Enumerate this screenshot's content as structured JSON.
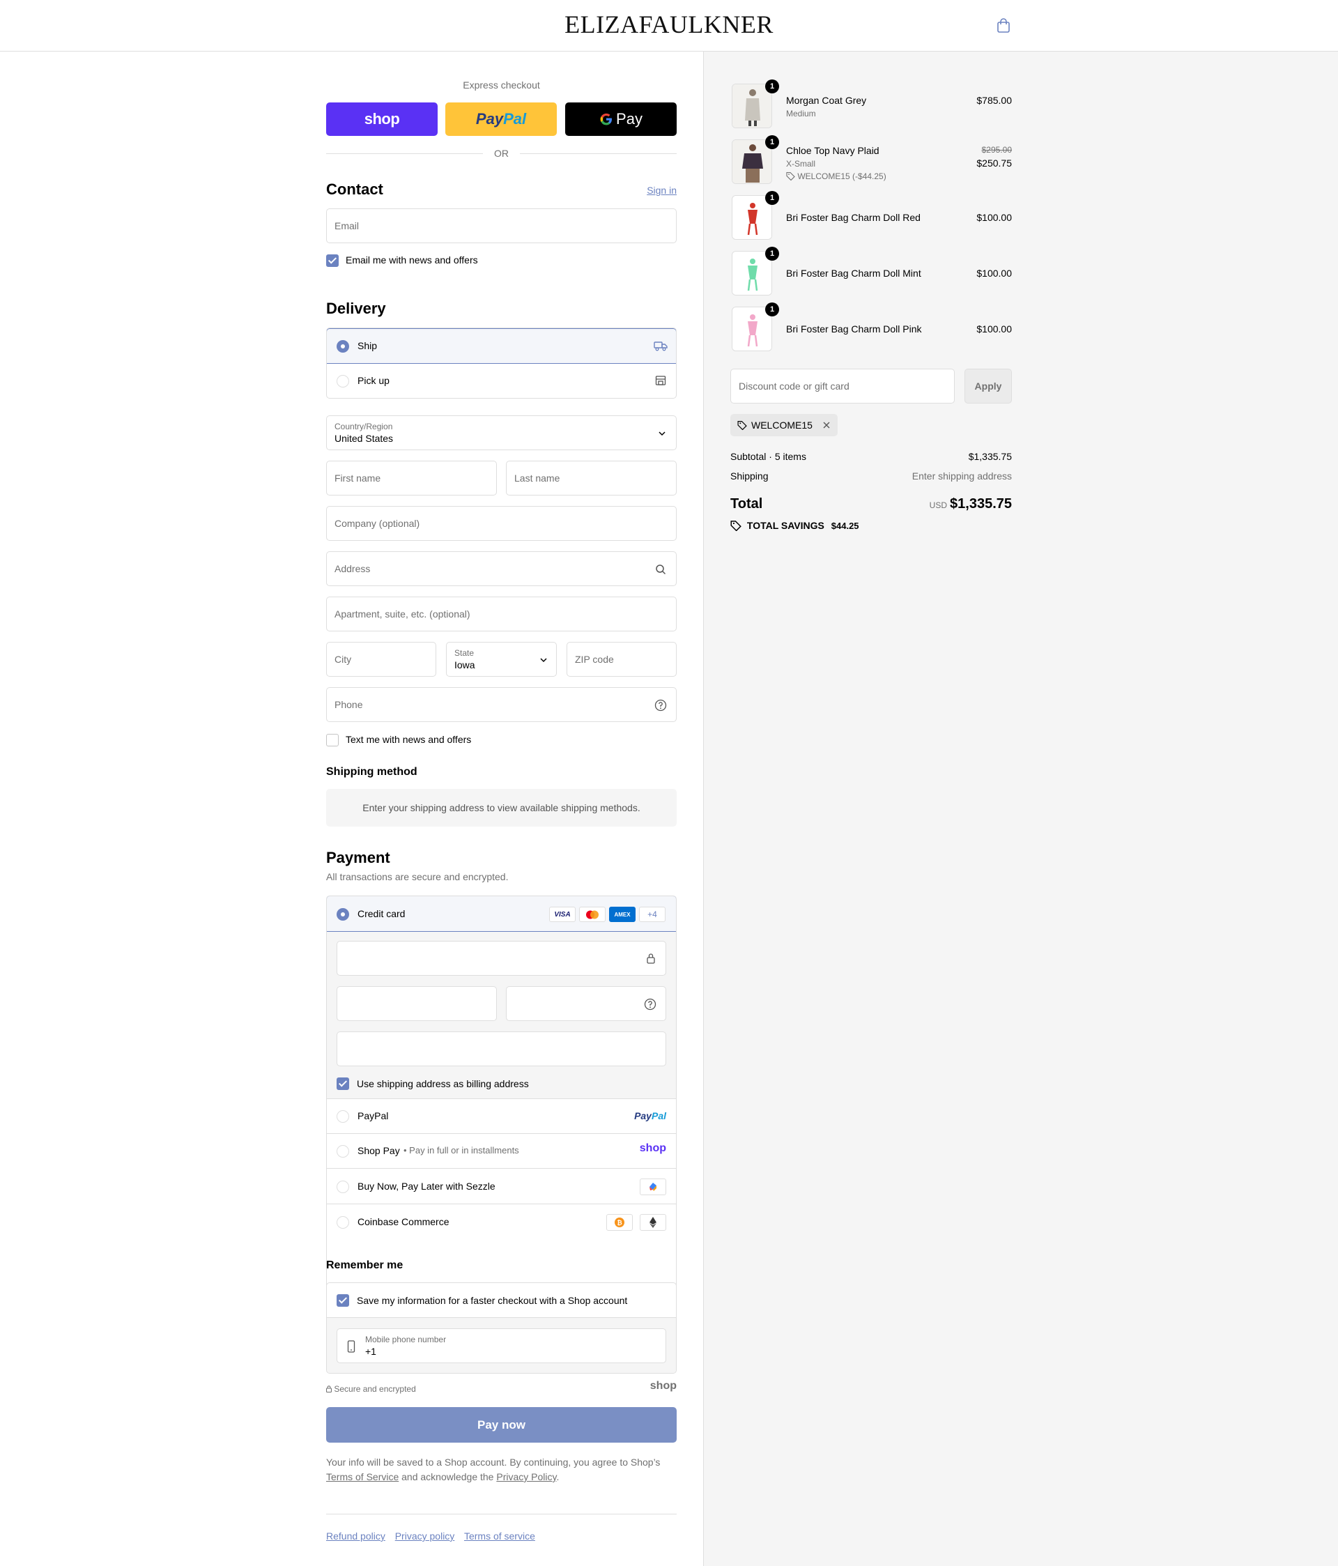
{
  "header": {
    "brand": "ELIZAFAULKNER",
    "cart_icon": "shopping-bag-icon"
  },
  "express": {
    "label": "Express checkout",
    "shop": "shop",
    "paypal_a": "Pay",
    "paypal_b": "Pal",
    "gpay": "Pay",
    "or": "OR"
  },
  "contact": {
    "title": "Contact",
    "sign_in": "Sign in",
    "email_placeholder": "Email",
    "news_label": "Email me with news and offers",
    "news_checked": true
  },
  "delivery": {
    "title": "Delivery",
    "options": [
      {
        "label": "Ship",
        "selected": true,
        "icon": "truck-icon"
      },
      {
        "label": "Pick up",
        "selected": false,
        "icon": "store-icon"
      }
    ],
    "country_label": "Country/Region",
    "country_value": "United States",
    "first_name": "First name",
    "last_name": "Last name",
    "company": "Company (optional)",
    "address": "Address",
    "apartment": "Apartment, suite, etc. (optional)",
    "city": "City",
    "state_label": "State",
    "state_value": "Iowa",
    "zip": "ZIP code",
    "phone": "Phone",
    "text_label": "Text me with news and offers",
    "text_checked": false
  },
  "shipping_method": {
    "title": "Shipping method",
    "info": "Enter your shipping address to view available shipping methods."
  },
  "payment": {
    "title": "Payment",
    "subtitle": "All transactions are secure and encrypted.",
    "credit_card": "Credit card",
    "card_brands": [
      "VISA",
      "",
      "AMEX",
      "+4"
    ],
    "billing_label": "Use shipping address as billing address",
    "billing_checked": true,
    "options": [
      {
        "label": "PayPal",
        "badge_a": "Pay",
        "badge_b": "Pal"
      },
      {
        "label": "Shop Pay",
        "sub": "Pay in full or in installments",
        "badge": "shop"
      },
      {
        "label": "Buy Now, Pay Later with Sezzle"
      },
      {
        "label": "Coinbase Commerce"
      }
    ]
  },
  "remember": {
    "title": "Remember me",
    "save_label": "Save my information for a faster checkout with a Shop account",
    "save_checked": true,
    "phone_label": "Mobile phone number",
    "phone_value": "+1",
    "secure": "Secure and encrypted",
    "shop": "shop"
  },
  "pay_button": "Pay now",
  "legal": {
    "line1": "Your info will be saved to a Shop account. By continuing, you agree to Shop’s",
    "tos": "Terms of Service",
    "mid": "and acknowledge the",
    "privacy": "Privacy Policy",
    "end": "."
  },
  "footer": {
    "links": [
      "Refund policy",
      "Privacy policy",
      "Terms of service"
    ]
  },
  "cart": {
    "items": [
      {
        "name": "Morgan Coat Grey",
        "variant": "Medium",
        "price": "$785.00",
        "qty": "1",
        "color": "#c9c5bd"
      },
      {
        "name": "Chloe Top Navy Plaid",
        "variant": "X-Small",
        "discount": "WELCOME15 (-$44.25)",
        "old_price": "$295.00",
        "price": "$250.75",
        "qty": "1",
        "color": "#3b2f3f"
      },
      {
        "name": "Bri Foster Bag Charm Doll Red",
        "price": "$100.00",
        "qty": "1",
        "color": "#d2362a"
      },
      {
        "name": "Bri Foster Bag Charm Doll Mint",
        "price": "$100.00",
        "qty": "1",
        "color": "#6fdcaa"
      },
      {
        "name": "Bri Foster Bag Charm Doll Pink",
        "price": "$100.00",
        "qty": "1",
        "color": "#f2a8c9"
      }
    ],
    "discount_placeholder": "Discount code or gift card",
    "apply": "Apply",
    "code": "WELCOME15",
    "subtotal_label": "Subtotal · 5 items",
    "subtotal": "$1,335.75",
    "shipping_label": "Shipping",
    "shipping_value": "Enter shipping address",
    "total_label": "Total",
    "currency": "USD",
    "total": "$1,335.75",
    "savings_label": "TOTAL SAVINGS",
    "savings": "$44.25"
  },
  "colors": {
    "accent": "#6b82c0",
    "shop": "#5a31f4",
    "paypal": "#ffc439",
    "paybtn": "#7a8fc4"
  }
}
